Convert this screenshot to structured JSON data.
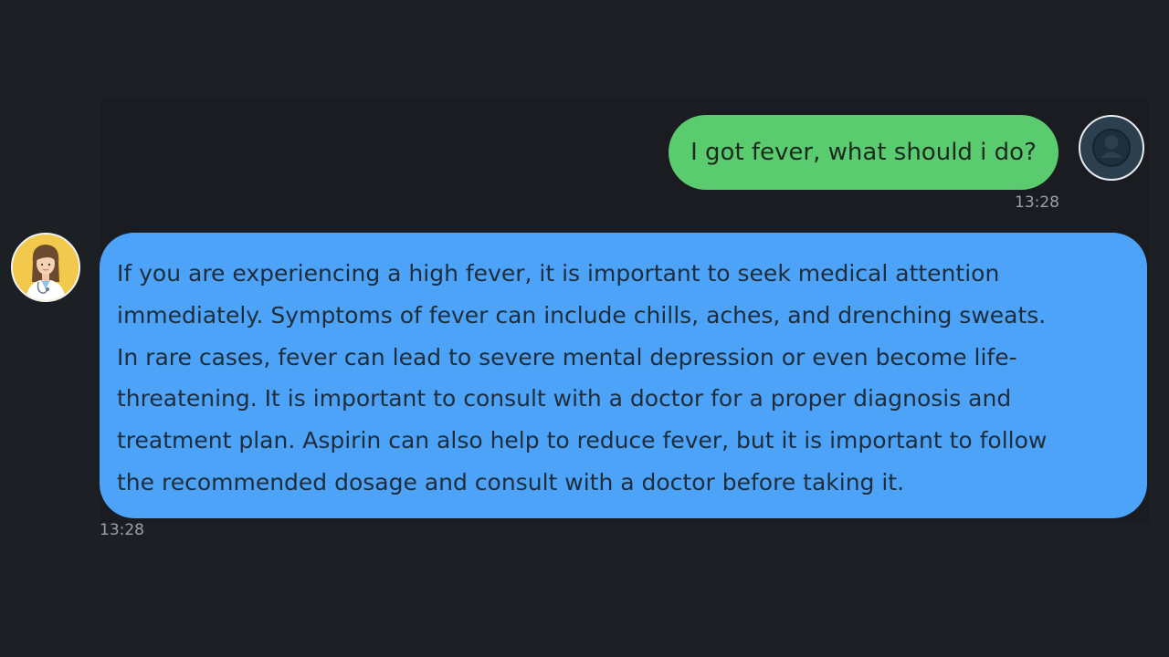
{
  "messages": {
    "user": {
      "text": "I got fever, what should i do?",
      "time": "13:28",
      "avatar_icon": "user-icon"
    },
    "bot": {
      "lines": [
        "If you are experiencing a high fever, it is important to seek medical attention",
        "immediately. Symptoms of fever can include chills, aches, and drenching sweats.",
        "In rare cases, fever can lead to severe mental depression or even become life-",
        "threatening. It is important to consult with a doctor for a proper diagnosis and",
        "treatment plan. Aspirin can also help to reduce fever, but it is important to follow",
        "the recommended dosage and consult with a doctor before taking it."
      ],
      "time": "13:28",
      "avatar_icon": "doctor-avatar-icon"
    }
  },
  "colors": {
    "background": "#1c1f24",
    "user_bubble": "#5bcb6f",
    "bot_bubble": "#4da3f7",
    "avatar_bot_bg": "#f2c94c",
    "avatar_user_bg": "#2b3f4f"
  }
}
